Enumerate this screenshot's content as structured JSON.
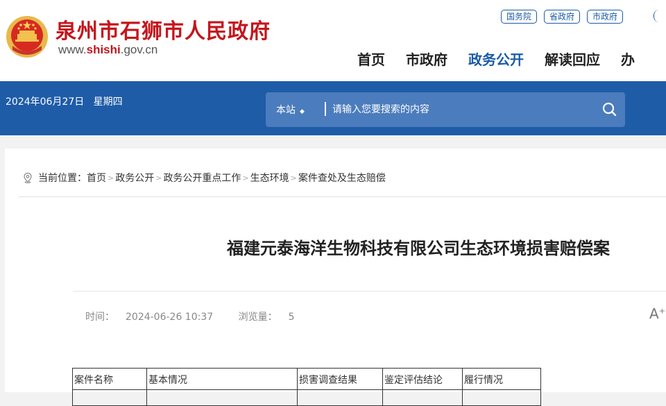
{
  "header": {
    "site_title": "泉州市石狮市人民政府",
    "site_url_prefix": "www.",
    "site_url_highlight": "shishi",
    "site_url_suffix": ".gov.cn",
    "top_links": [
      "国务院",
      "省政府",
      "市政府"
    ],
    "nav": [
      "首页",
      "市政府",
      "政务公开",
      "解读回应",
      "办"
    ],
    "active_nav": "政务公开"
  },
  "bar": {
    "date": "2024年06月27日",
    "weekday": "星期四",
    "search_scope": "本站",
    "search_placeholder": "请输入您要搜索的内容"
  },
  "breadcrumb": {
    "prefix": "当前位置：",
    "items": [
      "首页",
      "政务公开",
      "政务公开重点工作",
      "生态环境",
      "案件查处及生态赔偿"
    ]
  },
  "article": {
    "title": "福建元泰海洋生物科技有限公司生态环境损害赔偿案",
    "time_label": "时间：",
    "time_value": "2024-06-26 10:37",
    "views_label": "浏览量：",
    "views_value": "5",
    "font_size_label": "A",
    "font_size_sup": "+"
  },
  "table": {
    "headers": [
      "案件名称",
      "基本情况",
      "损害调查结果",
      "鉴定评估结论",
      "履行情况"
    ]
  },
  "colors": {
    "brand_red": "#c4161c",
    "brand_blue": "#1f5ca8",
    "search_bg": "#4b7cbd"
  }
}
